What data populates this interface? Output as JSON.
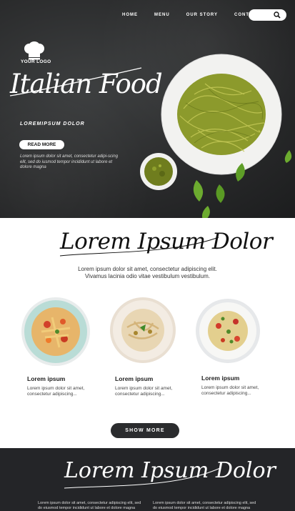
{
  "nav": {
    "items": [
      "HOME",
      "MENU",
      "OUR STORY",
      "CONTACT US"
    ]
  },
  "search": {
    "icon": "search-icon"
  },
  "logo": {
    "text": "YOUR LOGO",
    "icon": "chef-hat-icon"
  },
  "hero": {
    "title": "Italian Food",
    "subtitle": "LOREMIPSUM DOLOR",
    "button": "READ MORE",
    "body": "Lorem ipsum dolor sit amet, consectetur adipi-scing elit, sed do iusmod tempor incididunt ut labore et dolore magna"
  },
  "section2": {
    "title": "Lorem Ipsum Dolor",
    "text_line1": "Lorem ipsum dolor sit amet, consectetur adipiscing elit.",
    "text_line2": "Vivamus lacinia odio vitae vestibulum vestibulum."
  },
  "dishes": [
    {
      "title": "Lorem ipsum",
      "text": "Lorem ipsum dolor sit amet, consectetur adipiscing..."
    },
    {
      "title": "Lorem ipsum",
      "text": "Lorem ipsum dolor sit amet, consectetur adipiscing..."
    },
    {
      "title": "Lorem ipsum",
      "text": "Lorem ipsum dolor sit amet, consectetur adipiscing..."
    }
  ],
  "show_more": "SHOW MORE",
  "footer": {
    "title": "Lorem Ipsum Dolor",
    "col1": "Lorem ipsum dolor sit amet, consectetur adipiscing elit, sed do eiusmod tempor incididunt ut labore et dolore magna",
    "col2": "Lorem ipsum dolor sit amet, consectetur adipiscing elit, sed do eiusmod tempor incididunt ut labore et dolore magna"
  },
  "colors": {
    "dark": "#2b2c2e",
    "footer": "#242528",
    "pesto": "#8a9a2e",
    "basil": "#6cab2f"
  }
}
